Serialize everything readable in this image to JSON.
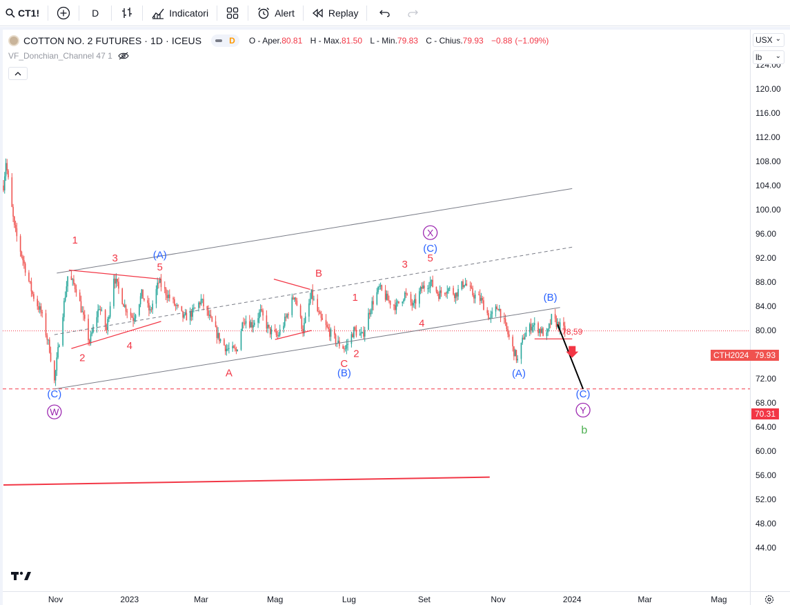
{
  "toolbar": {
    "symbol": "CT1!",
    "interval": "D",
    "indicators_label": "Indicatori",
    "alert_label": "Alert",
    "replay_label": "Replay"
  },
  "legend": {
    "title": "COTTON NO. 2 FUTURES · 1D · ICEUS",
    "interval_badge": "D",
    "open_label": "O",
    "open_key": "Aper.",
    "open_value": "80.81",
    "high_label": "H",
    "high_key": "Max.",
    "high_value": "81.50",
    "low_label": "L",
    "low_key": "Min.",
    "low_value": "79.83",
    "close_label": "C",
    "close_key": "Chius.",
    "close_value": "79.93",
    "change_value": "−0.88",
    "change_pct": "(−1.09%)"
  },
  "indicator": {
    "name": "VF_Donchian_Channel 47 1"
  },
  "price_scale": {
    "currency": "USX",
    "unit": "lb",
    "labels": [
      "124.00",
      "120.00",
      "116.00",
      "112.00",
      "108.00",
      "104.00",
      "100.00",
      "96.00",
      "92.00",
      "88.00",
      "84.00",
      "80.00",
      "76.00",
      "72.00",
      "68.00",
      "64.00",
      "60.00",
      "56.00",
      "52.00",
      "48.00",
      "44.00"
    ],
    "last_price": "79.93",
    "level_price": "70.31",
    "symbol_tag": "CTH2024"
  },
  "time_scale": {
    "labels": [
      "Nov",
      "2023",
      "Mar",
      "Mag",
      "Lug",
      "Set",
      "Nov",
      "2024",
      "Mar",
      "Mag"
    ]
  },
  "colors": {
    "bull": "#26a69a",
    "bear": "#ef5350",
    "wave_red": "#f23645",
    "wave_blue": "#2962ff",
    "wave_purple": "#9c27b0",
    "wave_green": "#4caf50"
  },
  "chart_data": {
    "type": "candlestick",
    "title": "COTTON NO. 2 FUTURES · 1D · ICEUS",
    "xlabel": "",
    "ylabel": "",
    "ylim": [
      42,
      127
    ],
    "x_range": [
      "2022-09-19",
      "2024-06-16"
    ],
    "grid": false,
    "anchors": [
      {
        "date": "2022-09-19",
        "price": 104
      },
      {
        "date": "2022-09-21",
        "price": 108
      },
      {
        "date": "2022-09-28",
        "price": 97
      },
      {
        "date": "2022-10-06",
        "price": 91
      },
      {
        "date": "2022-10-13",
        "price": 86
      },
      {
        "date": "2022-10-20",
        "price": 83
      },
      {
        "date": "2022-10-27",
        "price": 77
      },
      {
        "date": "2022-10-31",
        "price": 71.5
      },
      {
        "date": "2022-11-05",
        "price": 80
      },
      {
        "date": "2022-11-11",
        "price": 89
      },
      {
        "date": "2022-11-18",
        "price": 87
      },
      {
        "date": "2022-11-24",
        "price": 82
      },
      {
        "date": "2022-11-29",
        "price": 78
      },
      {
        "date": "2022-12-07",
        "price": 84
      },
      {
        "date": "2022-12-13",
        "price": 80
      },
      {
        "date": "2022-12-19",
        "price": 89
      },
      {
        "date": "2022-12-28",
        "price": 84
      },
      {
        "date": "2023-01-04",
        "price": 82
      },
      {
        "date": "2023-01-11",
        "price": 86
      },
      {
        "date": "2023-01-18",
        "price": 83
      },
      {
        "date": "2023-01-25",
        "price": 88
      },
      {
        "date": "2023-02-01",
        "price": 86
      },
      {
        "date": "2023-02-08",
        "price": 84
      },
      {
        "date": "2023-02-15",
        "price": 82
      },
      {
        "date": "2023-02-22",
        "price": 83
      },
      {
        "date": "2023-03-01",
        "price": 85
      },
      {
        "date": "2023-03-08",
        "price": 82
      },
      {
        "date": "2023-03-15",
        "price": 79
      },
      {
        "date": "2023-03-22",
        "price": 77
      },
      {
        "date": "2023-03-30",
        "price": 76.5
      },
      {
        "date": "2023-04-05",
        "price": 82
      },
      {
        "date": "2023-04-12",
        "price": 81
      },
      {
        "date": "2023-04-19",
        "price": 83
      },
      {
        "date": "2023-04-26",
        "price": 80
      },
      {
        "date": "2023-05-03",
        "price": 79
      },
      {
        "date": "2023-05-10",
        "price": 82
      },
      {
        "date": "2023-05-17",
        "price": 86
      },
      {
        "date": "2023-05-24",
        "price": 80
      },
      {
        "date": "2023-05-31",
        "price": 86
      },
      {
        "date": "2023-06-07",
        "price": 82
      },
      {
        "date": "2023-06-14",
        "price": 80
      },
      {
        "date": "2023-06-21",
        "price": 78
      },
      {
        "date": "2023-06-28",
        "price": 77
      },
      {
        "date": "2023-07-05",
        "price": 80
      },
      {
        "date": "2023-07-12",
        "price": 79
      },
      {
        "date": "2023-07-19",
        "price": 84
      },
      {
        "date": "2023-07-26",
        "price": 87
      },
      {
        "date": "2023-08-02",
        "price": 85
      },
      {
        "date": "2023-08-09",
        "price": 84
      },
      {
        "date": "2023-08-16",
        "price": 86
      },
      {
        "date": "2023-08-23",
        "price": 84
      },
      {
        "date": "2023-08-30",
        "price": 87
      },
      {
        "date": "2023-09-06",
        "price": 88
      },
      {
        "date": "2023-09-13",
        "price": 86
      },
      {
        "date": "2023-09-20",
        "price": 87
      },
      {
        "date": "2023-09-27",
        "price": 86
      },
      {
        "date": "2023-10-04",
        "price": 88
      },
      {
        "date": "2023-10-11",
        "price": 86
      },
      {
        "date": "2023-10-18",
        "price": 85
      },
      {
        "date": "2023-10-25",
        "price": 82
      },
      {
        "date": "2023-11-01",
        "price": 84
      },
      {
        "date": "2023-11-08",
        "price": 80
      },
      {
        "date": "2023-11-13",
        "price": 77
      },
      {
        "date": "2023-11-17",
        "price": 75
      },
      {
        "date": "2023-11-22",
        "price": 79
      },
      {
        "date": "2023-11-29",
        "price": 81
      },
      {
        "date": "2023-12-06",
        "price": 80
      },
      {
        "date": "2023-12-11",
        "price": 79
      },
      {
        "date": "2023-12-15",
        "price": 82
      },
      {
        "date": "2023-12-20",
        "price": 81
      },
      {
        "date": "2023-12-26",
        "price": 79.93
      }
    ],
    "last": {
      "open": 80.81,
      "high": 81.5,
      "low": 79.83,
      "close": 79.93,
      "change": -0.88,
      "change_pct": -1.09
    },
    "levels": [
      {
        "price": 70.31,
        "style": "dashed",
        "color": "#f23645"
      },
      {
        "price": 79.93,
        "style": "dotted",
        "color": "#f23645"
      }
    ],
    "annotations": {
      "price_note": "78,59",
      "red_wave_labels": [
        {
          "text": "1",
          "date": "2022-11-17",
          "price": 95
        },
        {
          "text": "3",
          "date": "2022-12-20",
          "price": 92
        },
        {
          "text": "5",
          "date": "2023-01-26",
          "price": 90.5
        },
        {
          "text": "2",
          "date": "2022-11-23",
          "price": 75.5
        },
        {
          "text": "4",
          "date": "2023-01-01",
          "price": 77.5
        },
        {
          "text": "A",
          "date": "2023-03-24",
          "price": 73
        },
        {
          "text": "B",
          "date": "2023-06-06",
          "price": 89.5
        },
        {
          "text": "C",
          "date": "2023-06-27",
          "price": 74.5
        },
        {
          "text": "2",
          "date": "2023-07-07",
          "price": 76.2
        },
        {
          "text": "1",
          "date": "2023-07-06",
          "price": 85.5
        },
        {
          "text": "3",
          "date": "2023-08-16",
          "price": 91
        },
        {
          "text": "4",
          "date": "2023-08-30",
          "price": 81.2
        },
        {
          "text": "5",
          "date": "2023-09-06",
          "price": 92
        },
        {
          "text": "78,59",
          "date": "2024-01-01",
          "price": 79.9
        }
      ],
      "blue_wave_labels": [
        {
          "text": "(A)",
          "date": "2023-01-26",
          "price": 92.5
        },
        {
          "text": "(C)",
          "date": "2022-10-31",
          "price": 69.5
        },
        {
          "text": "(B)",
          "date": "2023-06-27",
          "price": 73
        },
        {
          "text": "(C)",
          "date": "2023-09-06",
          "price": 93.6
        },
        {
          "text": "(A)",
          "date": "2023-11-18",
          "price": 72.9
        },
        {
          "text": "(B)",
          "date": "2023-12-14",
          "price": 85.5
        },
        {
          "text": "(C)",
          "date": "2024-01-10",
          "price": 69.5
        }
      ],
      "circled_labels": [
        {
          "text": "W",
          "date": "2022-10-31",
          "price": 66.5,
          "color": "#9c27b0"
        },
        {
          "text": "X",
          "date": "2023-09-06",
          "price": 96.2,
          "color": "#9c27b0"
        },
        {
          "text": "Y",
          "date": "2024-01-10",
          "price": 66.8,
          "color": "#9c27b0"
        }
      ],
      "green_labels": [
        {
          "text": "b",
          "date": "2024-01-11",
          "price": 63.5
        }
      ],
      "channel_lines": [
        {
          "from": {
            "date": "2022-10-31",
            "price": 70.3
          },
          "to": {
            "date": "2023-12-22",
            "price": 83.8
          },
          "style": "solid",
          "color": "#787b86"
        },
        {
          "from": {
            "date": "2022-10-31",
            "price": 79.3
          },
          "to": {
            "date": "2024-01-01",
            "price": 93.8
          },
          "style": "dashed",
          "color": "#787b86"
        },
        {
          "from": {
            "date": "2022-11-02",
            "price": 89.5
          },
          "to": {
            "date": "2024-01-01",
            "price": 103.5
          },
          "style": "solid",
          "color": "#787b86"
        }
      ],
      "trendlines": [
        {
          "from": {
            "date": "2022-11-12",
            "price": 90
          },
          "to": {
            "date": "2023-01-27",
            "price": 88.5
          },
          "color": "#f23645"
        },
        {
          "from": {
            "date": "2022-11-14",
            "price": 77
          },
          "to": {
            "date": "2023-01-27",
            "price": 81.5
          },
          "color": "#f23645"
        },
        {
          "from": {
            "date": "2023-04-30",
            "price": 88.5
          },
          "to": {
            "date": "2023-05-30",
            "price": 86.8
          },
          "color": "#f23645"
        },
        {
          "from": {
            "date": "2023-05-01",
            "price": 78.5
          },
          "to": {
            "date": "2023-05-31",
            "price": 80
          },
          "color": "#f23645"
        },
        {
          "from": {
            "date": "2023-12-01",
            "price": 78.6
          },
          "to": {
            "date": "2024-01-01",
            "price": 78.6
          },
          "color": "#f23645"
        },
        {
          "from": {
            "date": "2022-09-19",
            "price": 54.4
          },
          "to": {
            "date": "2023-10-25",
            "price": 55.7
          },
          "color": "#f23645",
          "width": 2
        }
      ],
      "projection": {
        "from": {
          "date": "2023-12-20",
          "price": 81
        },
        "to": {
          "date": "2024-01-10",
          "price": 70.3
        },
        "color": "#000000"
      },
      "arrow": {
        "date": "2024-01-01",
        "price": 76.5,
        "direction": "down",
        "color": "#f23645"
      }
    }
  }
}
